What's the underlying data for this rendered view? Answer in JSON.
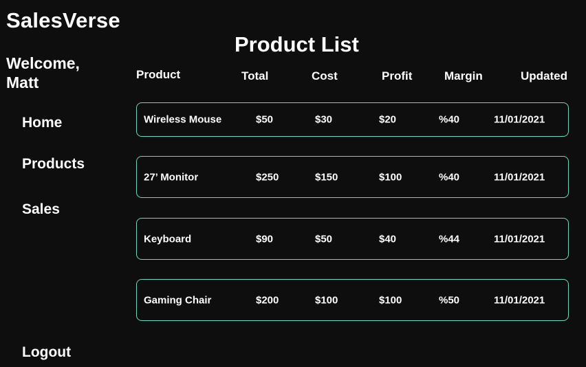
{
  "app": {
    "brand": "SalesVerse",
    "welcome": "Welcome, Matt"
  },
  "sidebar": {
    "items": [
      {
        "label": "Home"
      },
      {
        "label": "Products"
      },
      {
        "label": "Sales"
      }
    ],
    "logout": "Logout"
  },
  "main": {
    "title": "Product List",
    "columns": [
      "Product",
      "Total",
      "Cost",
      "Profit",
      "Margin",
      "Updated"
    ],
    "rows": [
      {
        "product": "Wireless Mouse",
        "total": "$50",
        "cost": "$30",
        "profit": "$20",
        "margin": "%40",
        "updated": "11/01/2021"
      },
      {
        "product": "27’ Monitor",
        "total": "$250",
        "cost": "$150",
        "profit": "$100",
        "margin": "%40",
        "updated": "11/01/2021"
      },
      {
        "product": "Keyboard",
        "total": "$90",
        "cost": "$50",
        "profit": "$40",
        "margin": "%44",
        "updated": "11/01/2021"
      },
      {
        "product": "Gaming Chair",
        "total": "$200",
        "cost": "$100",
        "profit": "$100",
        "margin": "%50",
        "updated": "11/01/2021"
      }
    ]
  },
  "colors": {
    "background": "#0e0e0e",
    "text": "#ffffff",
    "row_border": "#6fd9bf"
  }
}
